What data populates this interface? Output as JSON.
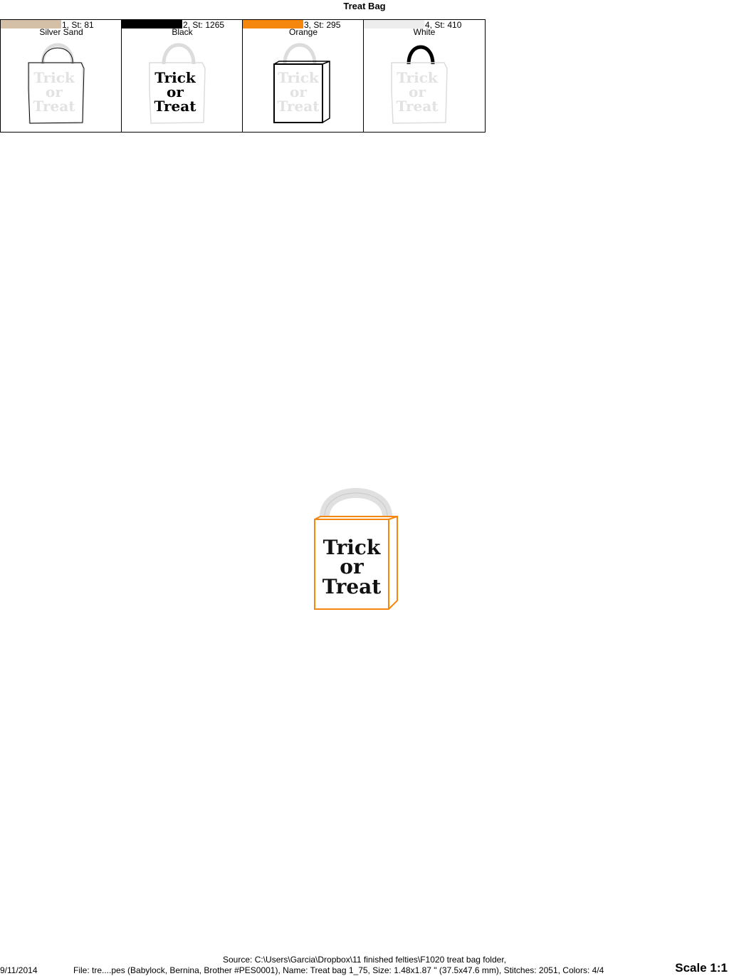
{
  "title": "Treat Bag",
  "colors": [
    {
      "index_label": "1, St: 81",
      "name": "Silver Sand",
      "hex": "#d4c0a7"
    },
    {
      "index_label": "2, St: 1265",
      "name": "Black",
      "hex": "#000000"
    },
    {
      "index_label": "3, St: 295",
      "name": "Orange",
      "hex": "#f5870f"
    },
    {
      "index_label": "4, St: 410",
      "name": "White",
      "hex": "#ededed"
    }
  ],
  "design_text": [
    "Trick",
    "or",
    "Treat"
  ],
  "footer": {
    "source": "Source: C:\\Users\\Garcia\\Dropbox\\11 finished felties\\F1020 treat bag folder,",
    "date": "9/11/2014",
    "file_info": "File: tre....pes (Babylock, Bernina, Brother #PES0001), Name: Treat bag 1_75, Size: 1.48x1.87 \" (37.5x47.6 mm), Stitches: 2051, Colors: 4/4",
    "scale": "Scale 1:1"
  }
}
